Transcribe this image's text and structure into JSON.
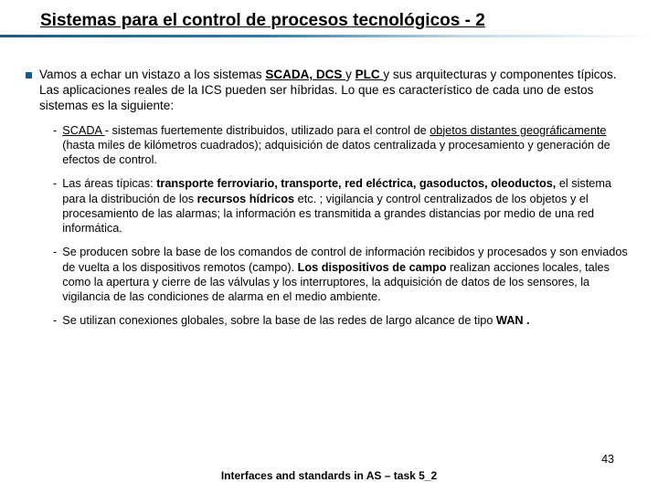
{
  "title": "Sistemas para el control de procesos tecnológicos - 2",
  "lead": {
    "pre": "Vamos a echar un vistazo a los sistemas ",
    "b1": "SCADA, DCS ",
    "mid1": "y ",
    "b2": "PLC ",
    "post": "y sus arquitecturas y componentes típicos. Las aplicaciones reales de la ICS pueden ser híbridas. Lo que es característico de cada uno de estos sistemas es la siguiente:"
  },
  "items": {
    "s1": {
      "a": "SCADA ",
      "b": "- sistemas fuertemente distribuidos, utilizado para el control de ",
      "c": "objetos distantes geográficamente ",
      "d": "(hasta miles de kilómetros cuadrados); adquisición de datos centralizada y procesamiento y  generación de efectos de control."
    },
    "s2": {
      "a": "Las áreas típicas: ",
      "b": "transporte ferroviario, transporte, red eléctrica, gasoductos, oleoductos, ",
      "c": "el sistema para la distribución de los ",
      "d": "recursos hídricos",
      "e": "  etc. ; vigilancia y control centralizados de los objetos y el procesamiento de las alarmas; la información es transmitida a grandes distancias por medio de una red informática."
    },
    "s3": {
      "a": "Se producen sobre la base de los comandos de control de información recibidos y procesados y son enviados de vuelta a los dispositivos remotos (campo). ",
      "b": "Los dispositivos de campo  ",
      "c": "realizan acciones locales, tales como la apertura y cierre de las válvulas y los interruptores, la adquisición de datos de los sensores, la vigilancia de las condiciones de alarma en el medio ambiente."
    },
    "s4": {
      "a": "Se utilizan conexiones globales, sobre la base de las redes de largo alcance de tipo ",
      "b": "WAN ."
    }
  },
  "footer": "Interfaces and standards in AS – task 5_2",
  "page": "43"
}
